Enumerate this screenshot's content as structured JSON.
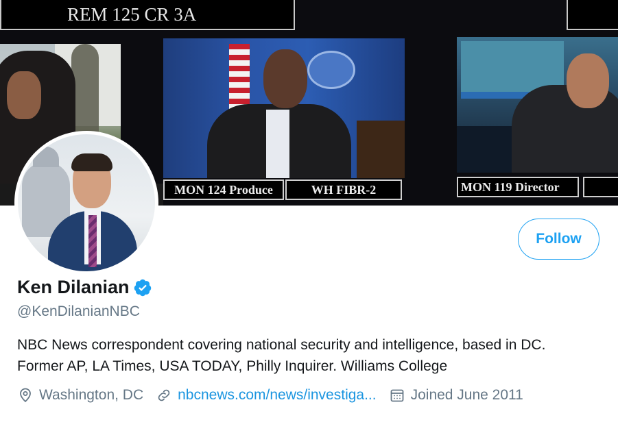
{
  "banner": {
    "top_label": "REM 125 CR 3A",
    "monitor_labels": [
      "MON 124 Produce",
      "WH FIBR-2",
      "MON 119 Director"
    ]
  },
  "profile": {
    "display_name": "Ken Dilanian",
    "verified": true,
    "handle": "@KenDilanianNBC",
    "bio_lines": [
      "NBC News correspondent covering national security and intelligence, based in DC.",
      "Former AP, LA Times, USA TODAY, Philly Inquirer. Williams College"
    ],
    "location": "Washington, DC",
    "website": "nbcnews.com/news/investiga...",
    "joined": "Joined June 2011"
  },
  "actions": {
    "follow_label": "Follow"
  },
  "icons": {
    "verified": "verified-badge-icon",
    "location": "location-pin-icon",
    "link": "link-icon",
    "calendar": "calendar-icon"
  },
  "colors": {
    "accent": "#1da1f2",
    "link": "#1b95e0",
    "secondary_text": "#657786",
    "primary_text": "#14171a"
  }
}
